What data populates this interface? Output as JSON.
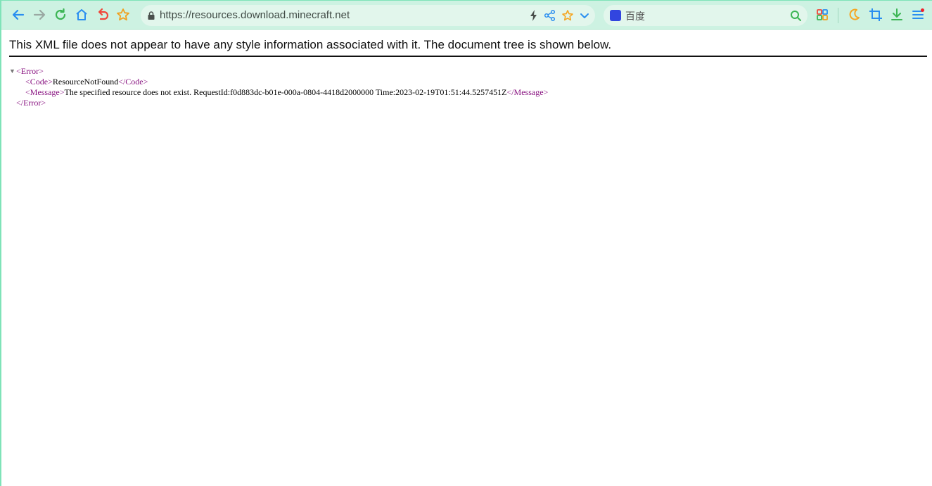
{
  "browser": {
    "url": "https://resources.download.minecraft.net",
    "search_placeholder": "百度",
    "colors": {
      "back": "#2a8ef0",
      "forward": "#9aa8a2",
      "reload": "#3cb554",
      "home": "#2a8ef0",
      "undo": "#f0463a",
      "bookmark": "#f0a020",
      "accent_orange": "#f5a623",
      "download": "#3cb554",
      "menu": "#2a8ef0"
    }
  },
  "page": {
    "banner": "This XML file does not appear to have any style information associated with it. The document tree is shown below.",
    "xml": {
      "root_open": "<Error>",
      "code_open": "<Code>",
      "code_value": "ResourceNotFound",
      "code_close": "</Code>",
      "message_open": "<Message>",
      "message_value": "The specified resource does not exist. RequestId:f0d883dc-b01e-000a-0804-4418d2000000 Time:2023-02-19T01:51:44.5257451Z",
      "message_close": "</Message>",
      "root_close": "</Error>"
    }
  }
}
